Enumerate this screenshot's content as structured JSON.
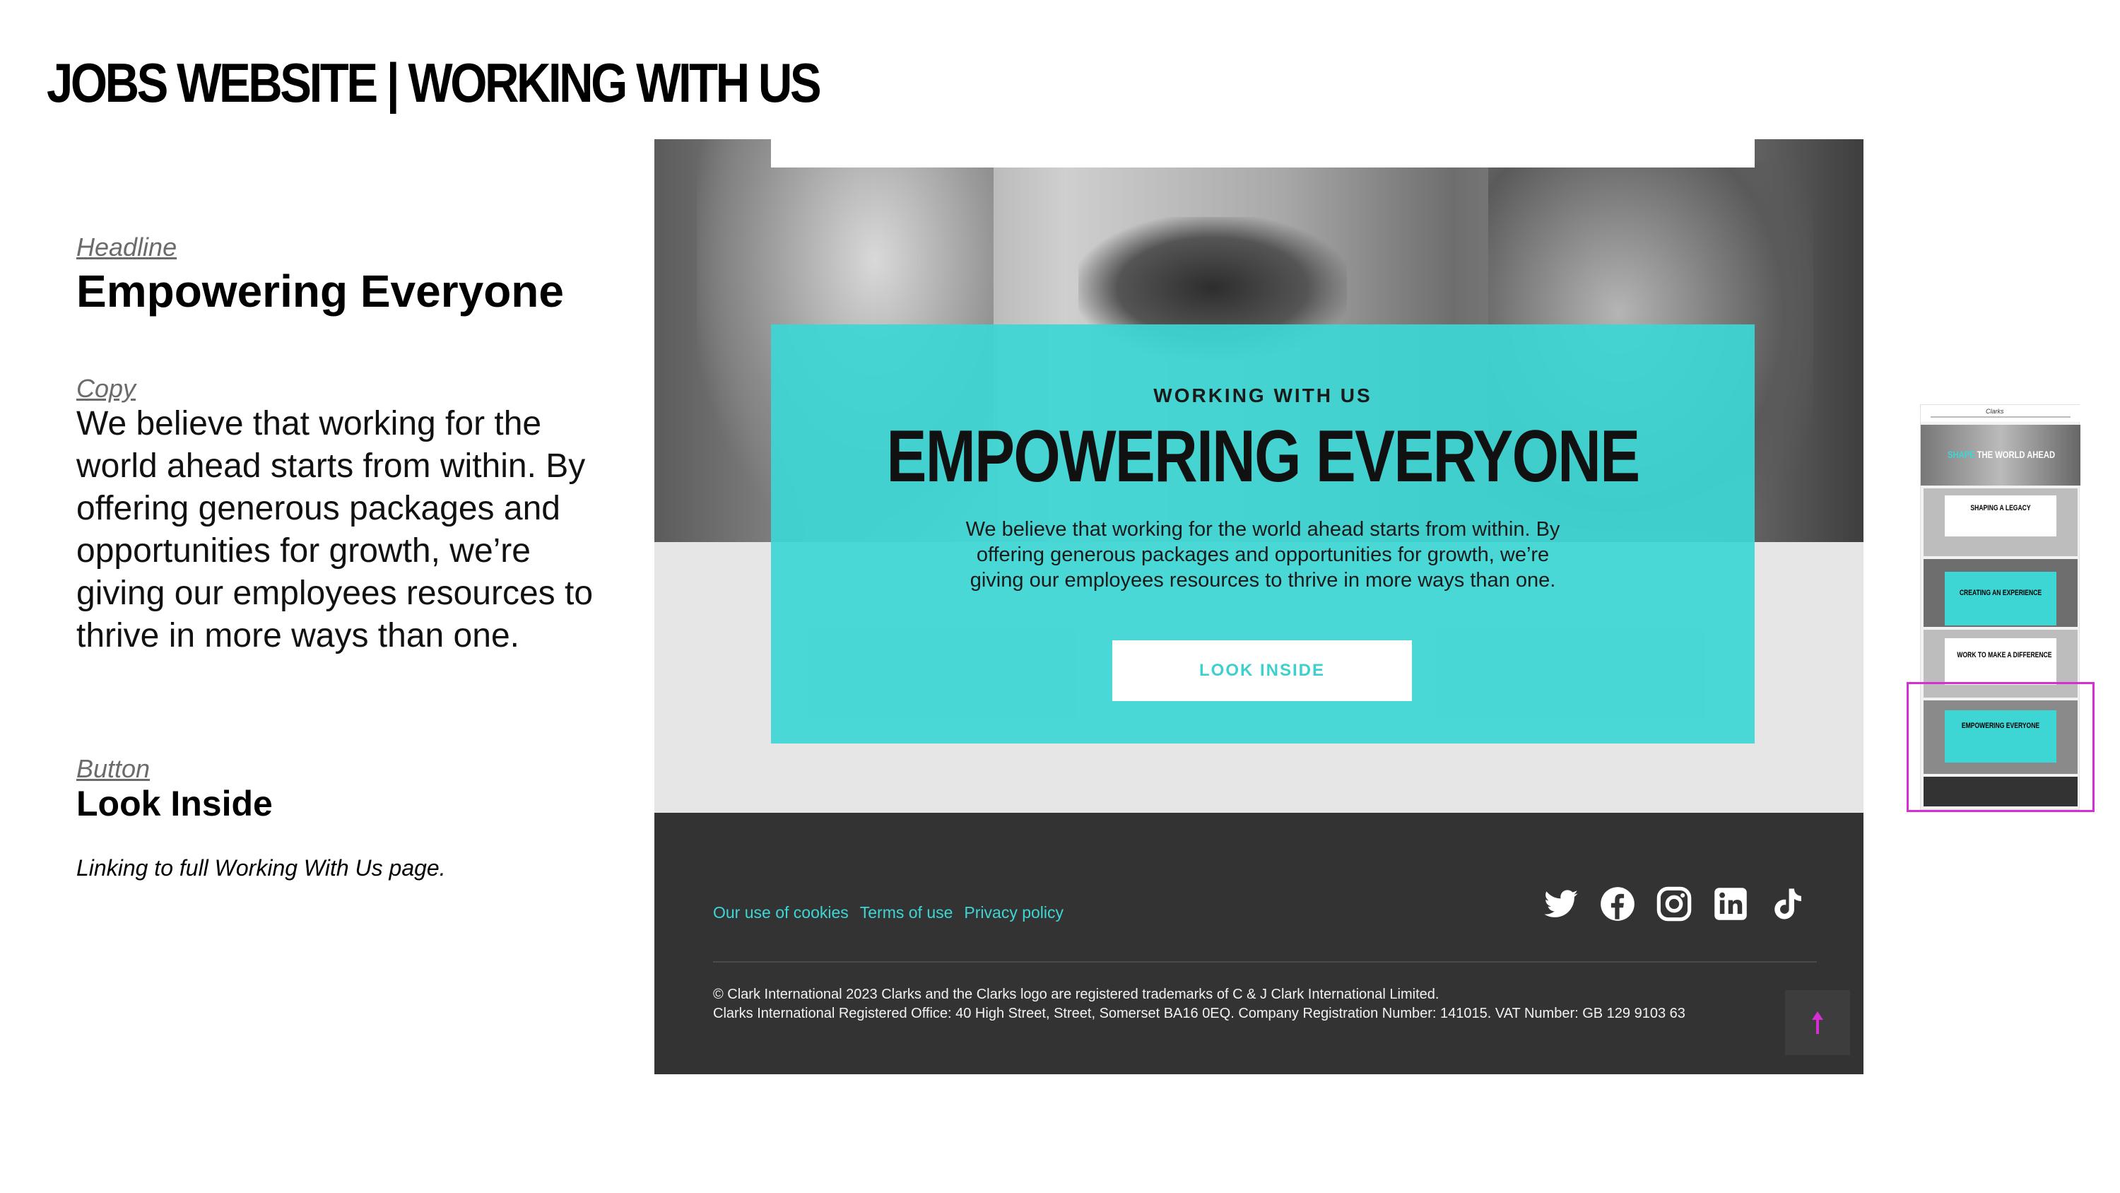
{
  "slide": {
    "title": "JOBS WEBSITE | WORKING WITH US"
  },
  "notes": {
    "headline_label": "Headline",
    "headline": "Empowering Everyone",
    "copy_label": "Copy",
    "copy": "We believe that working for the world ahead starts from within. By offering generous packages and opportunities for growth, we’re giving our employees resources to thrive in more ways than one.",
    "button_label": "Button",
    "button": "Look Inside",
    "link_note": "Linking to full Working With Us page."
  },
  "mock": {
    "eyebrow": "WORKING WITH US",
    "title": "EMPOWERING EVERYONE",
    "copy": "We believe that working for the world ahead starts from within. By offering generous packages and opportunities for growth, we’re giving our employees resources to thrive in more ways than one.",
    "cta": "LOOK INSIDE",
    "footer": {
      "links": [
        "Our use of cookies",
        "Terms of use",
        "Privacy policy"
      ],
      "socials": [
        "twitter-icon",
        "facebook-icon",
        "instagram-icon",
        "linkedin-icon",
        "tiktok-icon"
      ],
      "legal_line1": "© Clark International 2023 Clarks and the Clarks logo are registered trademarks of C & J Clark International Limited.",
      "legal_line2": "Clarks International Registered Office: 40 High Street, Street, Somerset BA16 0EQ. Company Registration Number: 141015. VAT Number: GB 129 9103 63",
      "back_to_top_icon": "arrow-up-icon"
    }
  },
  "thumbnail": {
    "logo": "Clarks",
    "hero_accent": "SHAPE",
    "hero": "THE WORLD AHEAD",
    "sections": [
      "SHAPING A LEGACY",
      "CREATING AN EXPERIENCE",
      "WORK TO MAKE A DIFFERENCE",
      "EMPOWERING EVERYONE"
    ]
  },
  "colors": {
    "teal": "#3dd6d4",
    "footer": "#333333",
    "highlight": "#d42ed4"
  }
}
